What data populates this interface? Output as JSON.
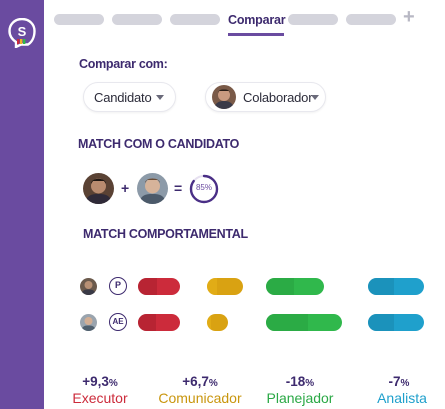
{
  "app": {
    "logo_letter": "S",
    "brand_color": "#6a4ba0"
  },
  "tabs": {
    "active_label": "Comparar",
    "add_icon": "+"
  },
  "compare": {
    "title": "Comparar com:",
    "candidate_select": "Candidato",
    "collaborator_select": "Colaborador"
  },
  "match": {
    "title": "MATCH COM O CANDIDATO",
    "plus": "+",
    "equals": "=",
    "percent_label": "85%",
    "percent_value": 85
  },
  "behavioral": {
    "title": "MATCH COMPORTAMENTAL",
    "rows": [
      {
        "badge": "P",
        "levels": [
          0.82,
          0.52,
          0.88,
          0.86
        ]
      },
      {
        "badge": "AE",
        "levels": [
          0.78,
          0.36,
          1.0,
          0.86
        ]
      }
    ],
    "colors": {
      "executor": "#cc2b3b",
      "comunicador": "#d9a212",
      "planejador": "#30b84c",
      "analista": "#1fa0cc"
    },
    "stats": [
      {
        "value": "+9,3",
        "unit": "%",
        "label": "Executor",
        "color": "#cc2b3b"
      },
      {
        "value": "+6,7",
        "unit": "%",
        "label": "Comunicador",
        "color": "#c9960e"
      },
      {
        "value": "-18",
        "unit": "%",
        "label": "Planejador",
        "color": "#2aa845"
      },
      {
        "value": "-7",
        "unit": "%",
        "label": "Analista",
        "color": "#1fa0cc"
      }
    ]
  }
}
